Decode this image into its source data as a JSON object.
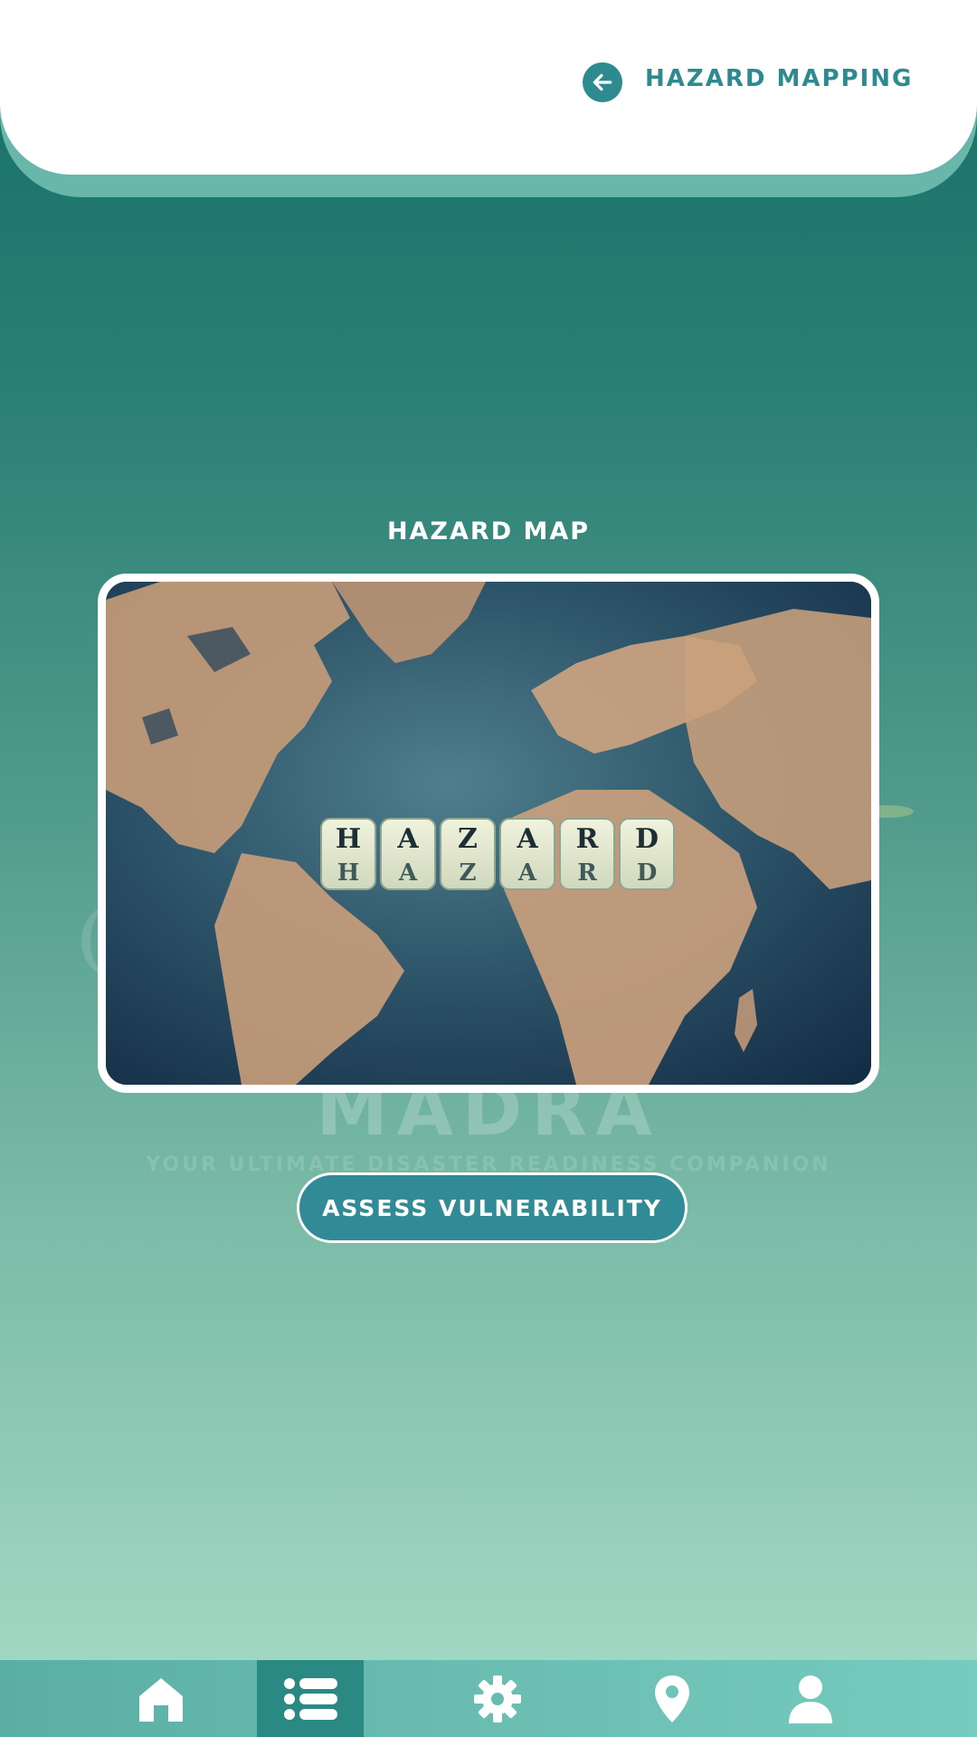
{
  "header": {
    "title": "HAZARD MAPPING",
    "back_icon": "arrow-left-circle-icon"
  },
  "watermark": {
    "title": "MADRA",
    "tagline": "YOUR ULTIMATE DISASTER READINESS COMPANION"
  },
  "section": {
    "title": "HAZARD MAP"
  },
  "image": {
    "description_icon": "world-map-hazard-photo",
    "tile_letters": [
      "H",
      "A",
      "Z",
      "A",
      "R",
      "D"
    ]
  },
  "actions": {
    "assess_label": "ASSESS VULNERABILITY"
  },
  "bottom_nav": {
    "items": [
      {
        "icon": "home-icon",
        "active": false
      },
      {
        "icon": "list-icon",
        "active": true
      },
      {
        "icon": "gear-icon",
        "active": false
      },
      {
        "icon": "map-pin-icon",
        "active": false
      },
      {
        "icon": "user-icon",
        "active": false
      }
    ]
  },
  "colors": {
    "accent": "#2d8b8f",
    "header_bg": "#ffffff",
    "header_shadow": "#68b7aa",
    "button_bg": "#318b97",
    "nav_active": "#2a8983",
    "map_ocean": "#1b3a4f",
    "map_land": "#d9a880"
  }
}
